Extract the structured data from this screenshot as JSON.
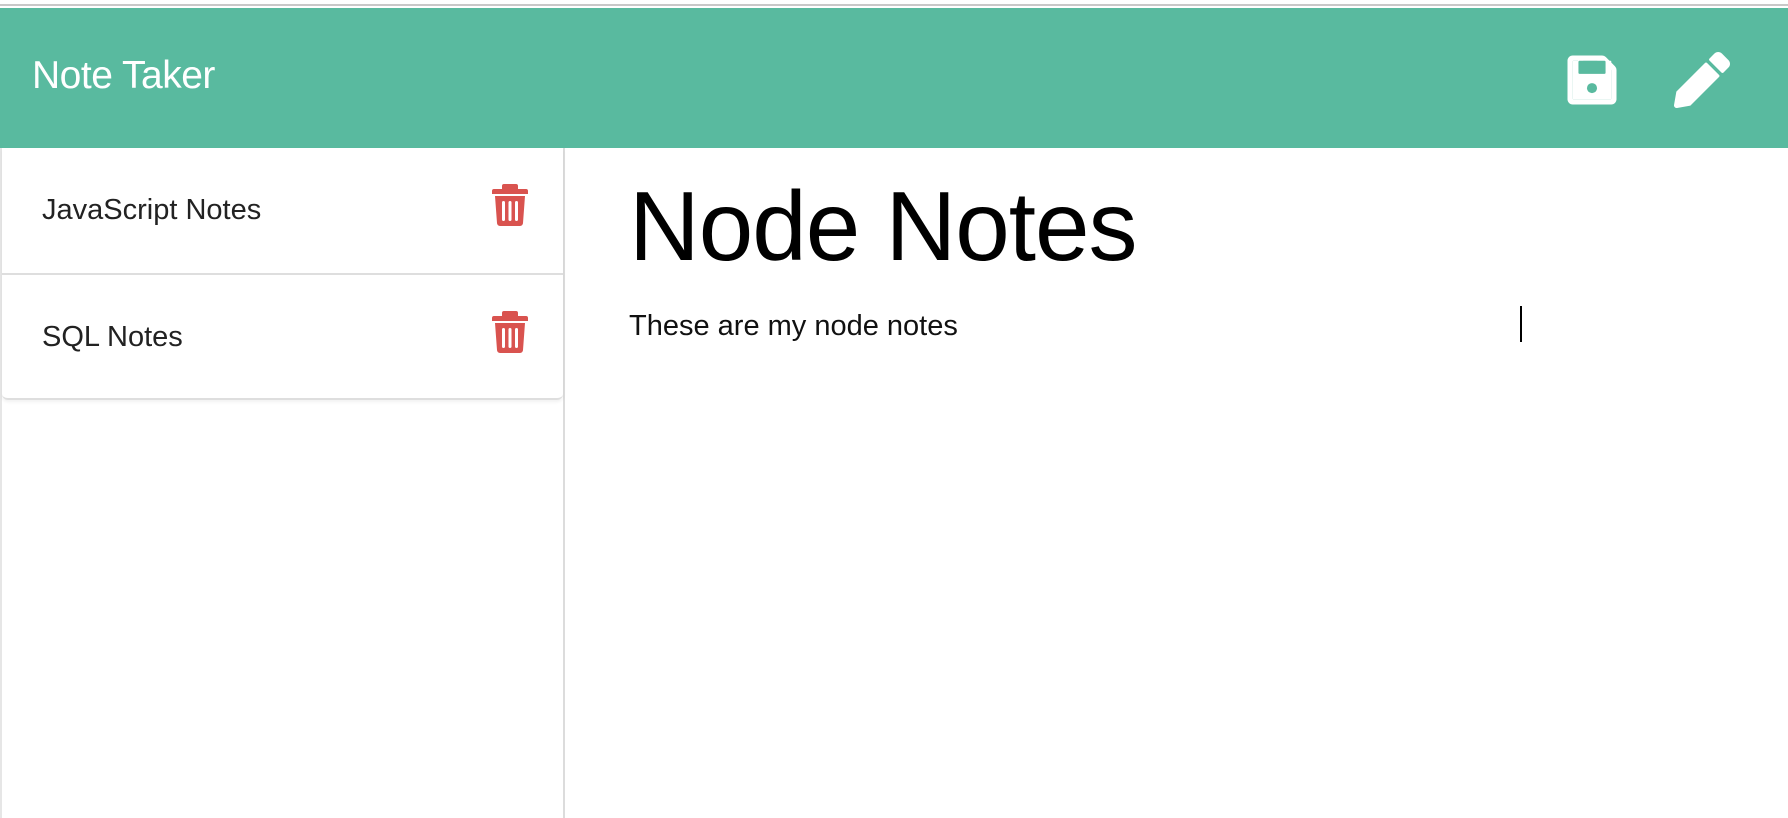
{
  "navbar": {
    "brand": "Note Taker",
    "save_icon": "floppy-disk-icon",
    "edit_icon": "pencil-icon",
    "background_color": "#59ba9f",
    "icon_color": "#ffffff"
  },
  "sidebar": {
    "notes": [
      {
        "title": "JavaScript Notes",
        "delete_icon": "trash-icon"
      },
      {
        "title": "SQL Notes",
        "delete_icon": "trash-icon"
      }
    ],
    "delete_color": "#d9534f"
  },
  "editor": {
    "title": "Node Notes",
    "body": "These are my node notes"
  }
}
